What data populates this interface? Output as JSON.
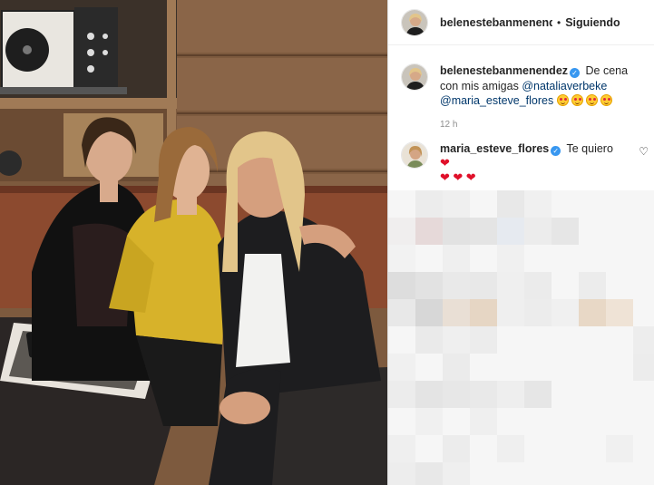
{
  "post": {
    "author": "belenestebanmenendez",
    "follow_status": "Siguiendo",
    "separator": "•",
    "caption": {
      "author": "belenestebanmenendez",
      "text": "De cena con mis amigas",
      "mentions": [
        "@nataliaverbeke",
        "@maria_esteve_flores"
      ],
      "emoji_count": 4,
      "timestamp": "12 h"
    },
    "comments": [
      {
        "author": "maria_esteve_flores",
        "text": "Te quiero",
        "hearts": [
          "❤",
          "❤",
          "❤",
          "❤"
        ]
      }
    ],
    "verified_icon": "verified-badge-icon",
    "like_icon": "heart-outline-icon",
    "like_glyph": "♡"
  },
  "colors": {
    "verified": "#3897f0",
    "mention": "#00376b",
    "heart": "#e0102a",
    "timestamp": "#8e8e8e"
  }
}
